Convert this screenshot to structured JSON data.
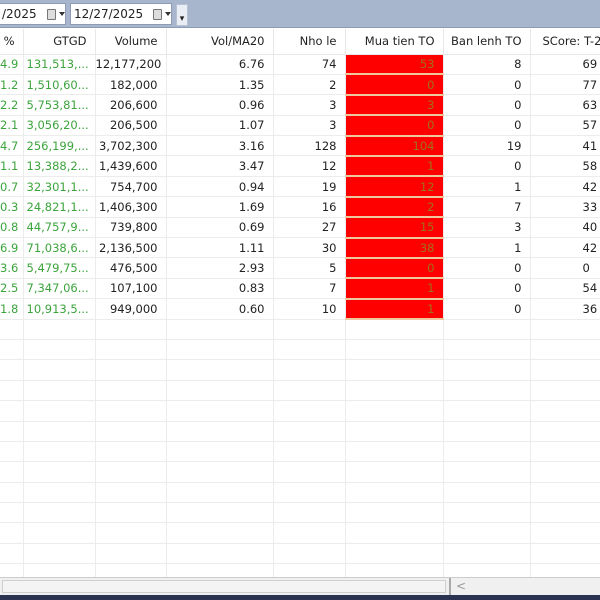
{
  "toolbar": {
    "date_from": "/2025",
    "date_to": "12/27/2025"
  },
  "columns": [
    "%",
    "GTGD",
    "Volume",
    "Vol/MA20",
    "Nho le",
    "Mua tien TO",
    "Ban lenh TO",
    "SCore: T-2"
  ],
  "rows": [
    [
      "4.9",
      "131,513,...",
      "12,177,200",
      "6.76",
      "74",
      "53",
      "8",
      "69"
    ],
    [
      "1.2",
      "1,510,60...",
      "182,000",
      "1.35",
      "2",
      "0",
      "0",
      "77"
    ],
    [
      "2.2",
      "5,753,81...",
      "206,600",
      "0.96",
      "3",
      "3",
      "0",
      "63"
    ],
    [
      "2.1",
      "3,056,20...",
      "206,500",
      "1.07",
      "3",
      "0",
      "0",
      "57"
    ],
    [
      "4.7",
      "256,199,...",
      "3,702,300",
      "3.16",
      "128",
      "104",
      "19",
      "41"
    ],
    [
      "1.1",
      "13,388,2...",
      "1,439,600",
      "3.47",
      "12",
      "1",
      "0",
      "58"
    ],
    [
      "0.7",
      "32,301,1...",
      "754,700",
      "0.94",
      "19",
      "12",
      "1",
      "42"
    ],
    [
      "0.3",
      "24,821,1...",
      "1,406,300",
      "1.69",
      "16",
      "2",
      "7",
      "33"
    ],
    [
      "0.8",
      "44,757,9...",
      "739,800",
      "0.69",
      "27",
      "15",
      "3",
      "40"
    ],
    [
      "6.9",
      "71,038,6...",
      "2,136,500",
      "1.11",
      "30",
      "38",
      "1",
      "42"
    ],
    [
      "3.6",
      "5,479,75...",
      "476,500",
      "2.93",
      "5",
      "0",
      "0",
      "0"
    ],
    [
      "2.5",
      "7,347,06...",
      "107,100",
      "0.83",
      "7",
      "1",
      "0",
      "54"
    ],
    [
      "1.8",
      "10,913,5...",
      "949,000",
      "0.60",
      "10",
      "1",
      "0",
      "36"
    ]
  ],
  "scroll": {
    "left_arrow": "<"
  },
  "colors": {
    "highlight": "#ff0000",
    "positive": "#3ca43c"
  }
}
